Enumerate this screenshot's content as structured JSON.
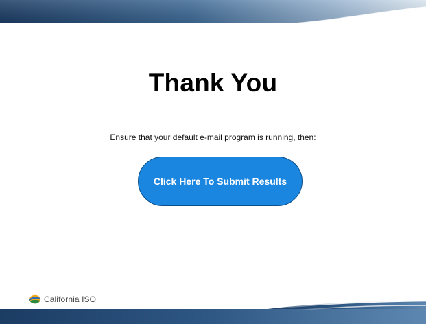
{
  "slide": {
    "title": "Thank You",
    "instruction": "Ensure that your default e-mail program is running, then:",
    "submit_label": "Click Here To Submit Results",
    "logo_text": "California ISO"
  },
  "colors": {
    "button_fill": "#1a86e0",
    "button_border": "#0d4f8a",
    "banner_dark": "#1c3f66",
    "banner_light": "#8fb0d0"
  },
  "icons": {
    "logo": "california-iso-logo"
  }
}
